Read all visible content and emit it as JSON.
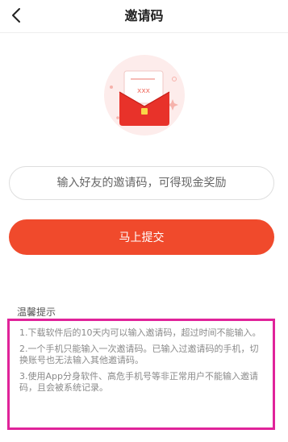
{
  "header": {
    "title": "邀请码"
  },
  "invite": {
    "placeholder": "输入好友的邀请码，可得现金奖励",
    "value": ""
  },
  "submit": {
    "label": "马上提交"
  },
  "tips": {
    "heading": "温馨提示",
    "items": [
      "1.下载软件后的10天内可以输入邀请码，超过时间不能输入。",
      "2.一个手机只能输入一次邀请码。已输入过邀请码的手机，切换账号也无法输入其他邀请码。",
      "3.使用App分身软件、高危手机号等非正常用户不能输入邀请码，且会被系统记录。"
    ]
  },
  "illustration": {
    "envelope_text": "xxx"
  },
  "colors": {
    "accent": "#f04a2c",
    "highlight_border": "#e0239a",
    "envelope_red": "#e8322a",
    "icon_bg": "#fdeceb"
  }
}
